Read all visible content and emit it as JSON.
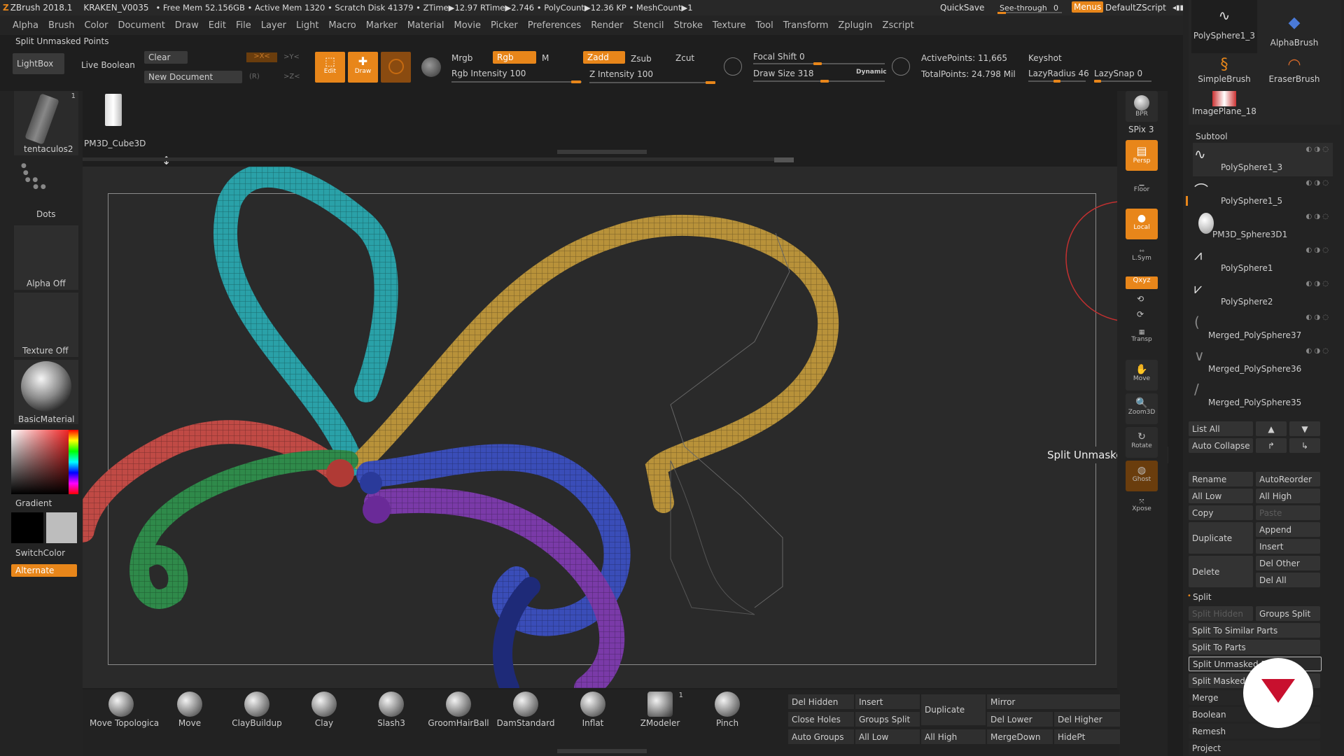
{
  "titlebar": {
    "app": "ZBrush 2018.1",
    "doc": "KRAKEN_V0035",
    "stats": "• Free Mem 52.156GB • Active Mem 1320 • Scratch Disk 41379 • ZTime▶12.97 RTime▶2.746 • PolyCount▶12.36 KP • MeshCount▶1",
    "quicksave": "QuickSave",
    "seethrough": "See-through",
    "seethrough_val": "0",
    "menus": "Menus",
    "script": "DefaultZScript"
  },
  "menus": [
    "Alpha",
    "Brush",
    "Color",
    "Document",
    "Draw",
    "Edit",
    "File",
    "Layer",
    "Light",
    "Macro",
    "Marker",
    "Material",
    "Movie",
    "Picker",
    "Preferences",
    "Render",
    "Stencil",
    "Stroke",
    "Texture",
    "Tool",
    "Transform",
    "Zplugin",
    "Zscript"
  ],
  "active_command": "Split Unmasked Points",
  "toolbar": {
    "lightbox": "LightBox",
    "live_boolean": "Live Boolean",
    "clear": "Clear",
    "new_document": "New Document",
    "x": ">X<",
    "y": ">Y<",
    "z": ">Z<",
    "r": "(R)",
    "edit": "Edit",
    "draw": "Draw",
    "mrgb": "Mrgb",
    "rgb": "Rgb",
    "m": "M",
    "zadd": "Zadd",
    "zsub": "Zsub",
    "zcut": "Zcut",
    "rgb_intensity": "Rgb Intensity 100",
    "z_intensity": "Z Intensity 100",
    "focal_shift": "Focal Shift 0",
    "draw_size": "Draw Size 318",
    "dynamic": "Dynamic",
    "active_points": "ActivePoints: 11,665",
    "total_points": "TotalPoints: 24.798 Mil",
    "keyshot": "Keyshot",
    "lazy_radius": "LazyRadius 46",
    "lazy_snap": "LazySnap 0"
  },
  "left_shelf": {
    "tool_thumb": "tentaculos2",
    "tool_count": "1",
    "dots": "Dots",
    "alpha": "Alpha Off",
    "texture": "Texture Off",
    "material": "BasicMaterial",
    "gradient": "Gradient",
    "switchcolor": "SwitchColor",
    "alternate": "Alternate",
    "cube": "PM3D_Cube3D"
  },
  "right_shelf": {
    "bpr": "BPR",
    "spix": "SPix 3",
    "persp": "Persp",
    "floor": "Floor",
    "local": "Local",
    "lsym": "L.Sym",
    "xyz": "Qxyz",
    "transp": "Transp",
    "move": "Move",
    "zoom3d": "Zoom3D",
    "rotate": "Rotate",
    "ghost": "Ghost",
    "xpose": "Xpose"
  },
  "tooltip": "Split Unmasked Points",
  "right_panel": {
    "brushes": [
      {
        "name": "PolySphere1_3"
      },
      {
        "name": "AlphaBrush"
      },
      {
        "name": "SimpleBrush"
      },
      {
        "name": "EraserBrush"
      },
      {
        "name": "ImagePlane_18"
      }
    ],
    "subtool_title": "Subtool",
    "subtools": [
      "PolySphere1_3",
      "PolySphere1_5",
      "PM3D_Sphere3D1",
      "PolySphere1",
      "PolySphere2",
      "Merged_PolySphere37",
      "Merged_PolySphere36",
      "Merged_PolySphere35"
    ],
    "list_all": "List All",
    "auto_collapse": "Auto Collapse",
    "rename": "Rename",
    "autoreorder": "AutoReorder",
    "all_low": "All Low",
    "all_high": "All High",
    "copy": "Copy",
    "paste": "Paste",
    "append": "Append",
    "duplicate": "Duplicate",
    "insert": "Insert",
    "delete": "Delete",
    "del_other": "Del Other",
    "del_all": "Del All",
    "split_title": "Split",
    "split_hidden": "Split Hidden",
    "groups_split": "Groups Split",
    "split_similar": "Split To Similar Parts",
    "split_parts": "Split To Parts",
    "split_unmasked": "Split Unmasked P",
    "split_masked": "Split Masked P",
    "merge": "Merge",
    "boolean": "Boolean",
    "remesh": "Remesh",
    "project": "Project"
  },
  "bottom_brushes": [
    "Move Topologica",
    "Move",
    "ClayBuildup",
    "Clay",
    "Slash3",
    "GroomHairBall",
    "DamStandard",
    "Inflat",
    "ZModeler",
    "Pinch"
  ],
  "zmodeler_count": "1",
  "bottom_buttons": {
    "del_hidden": "Del Hidden",
    "insert": "Insert",
    "duplicate": "Duplicate",
    "mirror": "Mirror",
    "close_holes": "Close Holes",
    "groups_split": "Groups Split",
    "del_lower": "Del Lower",
    "del_higher": "Del Higher",
    "auto_groups": "Auto Groups",
    "all_low": "All Low",
    "all_high": "All High",
    "mergedown": "MergeDown",
    "hidept": "HidePt"
  },
  "colors": {
    "accent": "#e8861a",
    "tentacle_teal": "#2aa1a8",
    "tentacle_gold": "#b8923a",
    "tentacle_red": "#c04a45",
    "tentacle_green": "#2f8a4a",
    "tentacle_blue": "#3a4db8",
    "tentacle_purple": "#7a3aa8",
    "tentacle_navy": "#1e2a78"
  }
}
